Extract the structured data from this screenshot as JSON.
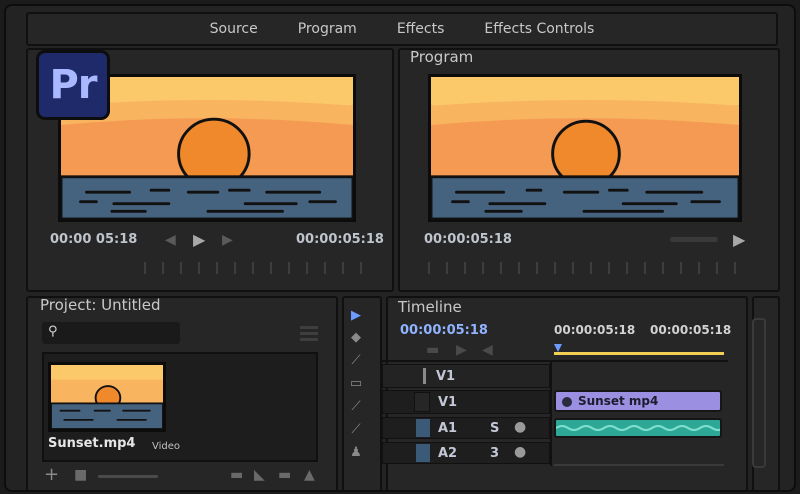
{
  "tabs": [
    "Source",
    "Program",
    "Effects",
    "Effects Controls"
  ],
  "logo": "Pr",
  "source": {
    "timecode_left": "00:00 05:18",
    "timecode_right": "00:00:05:18"
  },
  "program": {
    "title": "Program",
    "timecode": "00:00:05:18"
  },
  "project": {
    "title": "Project: Untitled",
    "clip_name": "Sunset.mp4",
    "clip_type": "Video"
  },
  "timeline": {
    "title": "Timeline",
    "current_timecode": "00:00:05:18",
    "ruler_timecodes": [
      "00:00:05:18",
      "00:00:05:18"
    ],
    "tracks": [
      {
        "label": "V1",
        "extra": ""
      },
      {
        "label": "V1",
        "extra": ""
      },
      {
        "label": "A1",
        "extra": "S"
      },
      {
        "label": "A2",
        "extra": "3"
      }
    ],
    "video_clip": "Sunset mp4"
  },
  "colors": {
    "accent_blue": "#6d9bff",
    "playhead_yellow": "#f2cf55",
    "video_clip": "#9a8fe0",
    "audio_clip": "#2ea896"
  },
  "icons": {
    "play": "▶",
    "step_back": "◀",
    "step_forward": "▶",
    "search": "⚲",
    "mic": "🎙"
  }
}
